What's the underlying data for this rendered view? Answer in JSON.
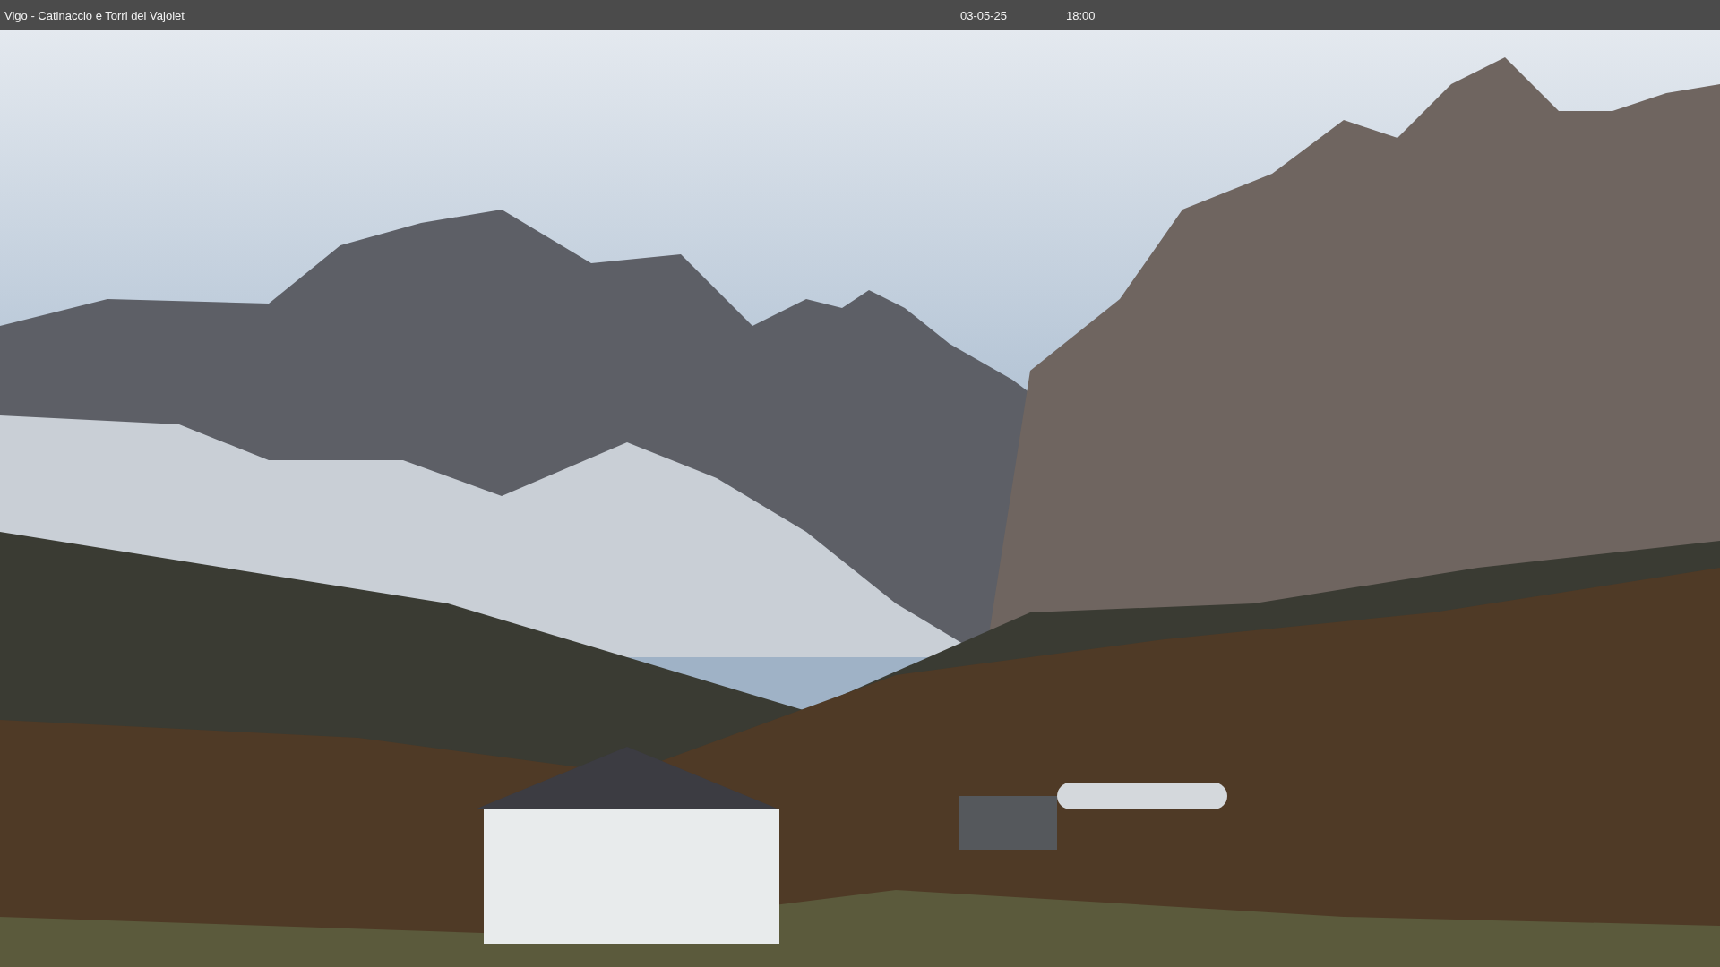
{
  "title_bar": {
    "title": "Vigo - Catinaccio e Torri del Vajolet",
    "date": "03-05-25",
    "time": "18:00"
  }
}
